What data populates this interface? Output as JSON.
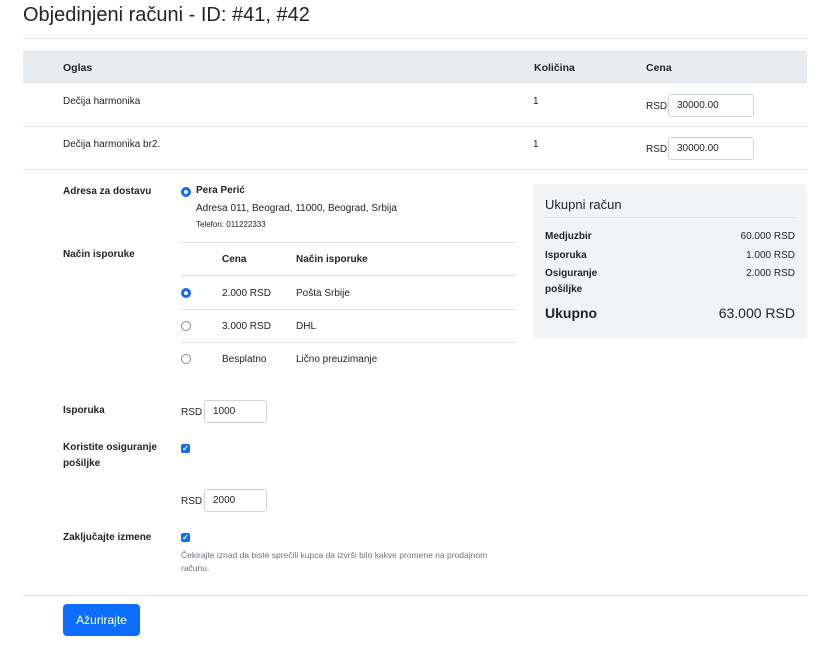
{
  "page_title": "Objedinjeni računi - ID: #41, #42",
  "items_table": {
    "headers": {
      "ad": "Oglas",
      "qty": "Količina",
      "price": "Cena"
    },
    "rows": [
      {
        "name": "Dečija harmonika",
        "qty": "1",
        "currency": "RSD",
        "price": "30000.00"
      },
      {
        "name": "Dečija harmonika br2.",
        "qty": "1",
        "currency": "RSD",
        "price": "30000.00"
      }
    ]
  },
  "shipping_address": {
    "label": "Adresa za dostavu",
    "name": "Pera Perić",
    "address": "Adresa 011, Beograd, 11000, Beograd, Srbija",
    "phone": "Telefon: 011222333"
  },
  "delivery_method": {
    "label": "Način isporuke",
    "headers": {
      "price": "Cena",
      "method": "Način isporuke"
    },
    "options": [
      {
        "price": "2.000 RSD",
        "method": "Pošta Srbije",
        "selected": true
      },
      {
        "price": "3.000 RSD",
        "method": "DHL",
        "selected": false
      },
      {
        "price": "Besplatno",
        "method": "Lično preuzimanje",
        "selected": false
      }
    ]
  },
  "delivery": {
    "label": "Isporuka",
    "currency": "RSD",
    "value": "1000"
  },
  "insurance": {
    "label": "Koristite osiguranje pošiljke",
    "checked": true,
    "currency": "RSD",
    "value": "2000"
  },
  "lock_changes": {
    "label": "Zaključajte izmene",
    "checked": true,
    "help": "Čekirajte iznad da biste sprečili kupca da izvrši bilo kakve promene na prodajnom računu."
  },
  "summary": {
    "title": "Ukupni račun",
    "rows": [
      {
        "label": "Medjuzbir",
        "value": "60.000 RSD"
      },
      {
        "label": "Isporuka",
        "value": "1.000 RSD"
      },
      {
        "label": "Osiguranje pošiljke",
        "value": "2.000 RSD"
      }
    ],
    "total_label": "Ukupno",
    "total_value": "63.000 RSD"
  },
  "update_button": "Ažurirajte",
  "colors": {
    "accent": "#0d6efd",
    "header_bg": "#e9ecef",
    "summary_bg": "#f1f3f5"
  }
}
